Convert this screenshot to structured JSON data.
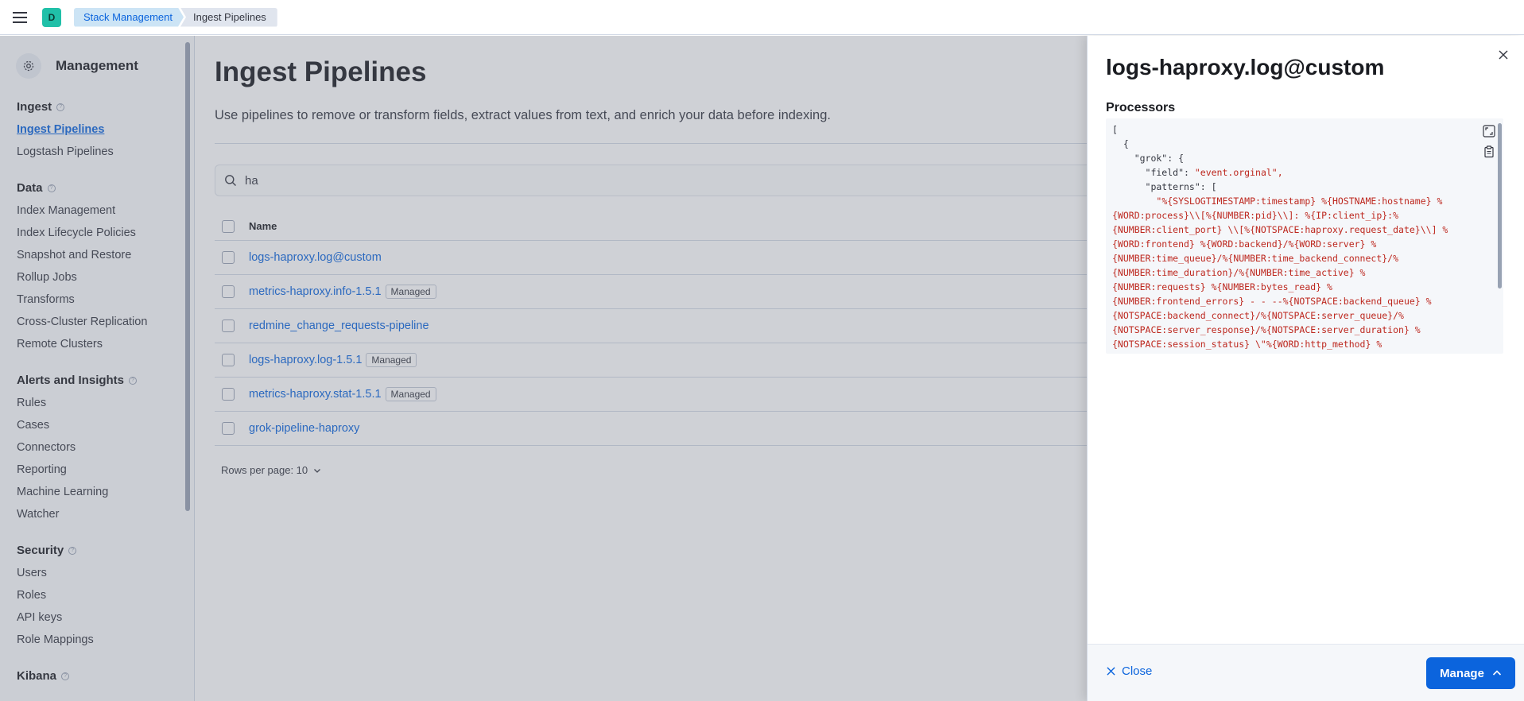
{
  "header": {
    "space_initial": "D",
    "breadcrumbs": [
      "Stack Management",
      "Ingest Pipelines"
    ]
  },
  "sidebar": {
    "title": "Management",
    "groups": [
      {
        "title": "Ingest",
        "items": [
          "Ingest Pipelines",
          "Logstash Pipelines"
        ]
      },
      {
        "title": "Data",
        "items": [
          "Index Management",
          "Index Lifecycle Policies",
          "Snapshot and Restore",
          "Rollup Jobs",
          "Transforms",
          "Cross-Cluster Replication",
          "Remote Clusters"
        ]
      },
      {
        "title": "Alerts and Insights",
        "items": [
          "Rules",
          "Cases",
          "Connectors",
          "Reporting",
          "Machine Learning",
          "Watcher"
        ]
      },
      {
        "title": "Security",
        "items": [
          "Users",
          "Roles",
          "API keys",
          "Role Mappings"
        ]
      },
      {
        "title": "Kibana",
        "items": []
      }
    ],
    "active_item": "Ingest Pipelines"
  },
  "main": {
    "title": "Ingest Pipelines",
    "description": "Use pipelines to remove or transform fields, extract values from text, and enrich your data before indexing.",
    "search_value": "ha",
    "table": {
      "name_header": "Name",
      "rows": [
        {
          "name": "logs-haproxy.log@custom",
          "badge": ""
        },
        {
          "name": "metrics-haproxy.info-1.5.1",
          "badge": "Managed"
        },
        {
          "name": "redmine_change_requests-pipeline",
          "badge": ""
        },
        {
          "name": "logs-haproxy.log-1.5.1",
          "badge": "Managed"
        },
        {
          "name": "metrics-haproxy.stat-1.5.1",
          "badge": "Managed"
        },
        {
          "name": "grok-pipeline-haproxy",
          "badge": ""
        }
      ]
    },
    "rows_per_page": "Rows per page: 10"
  },
  "flyout": {
    "title": "logs-haproxy.log@custom",
    "processors_label": "Processors",
    "code_lines": [
      {
        "k": "[",
        "s": ""
      },
      {
        "k": "  {",
        "s": ""
      },
      {
        "k": "    \"grok\": {",
        "s": ""
      },
      {
        "k": "      \"field\": ",
        "s": "\"event.orginal\","
      },
      {
        "k": "      \"patterns\": [",
        "s": ""
      },
      {
        "k": "        ",
        "s": "\"%{SYSLOGTIMESTAMP:timestamp} %{HOSTNAME:hostname} %"
      },
      {
        "k": "",
        "s": "{WORD:process}\\\\[%{NUMBER:pid}\\\\]: %{IP:client_ip}:%"
      },
      {
        "k": "",
        "s": "{NUMBER:client_port} \\\\[%{NOTSPACE:haproxy.request_date}\\\\] %"
      },
      {
        "k": "",
        "s": "{WORD:frontend} %{WORD:backend}/%{WORD:server} %"
      },
      {
        "k": "",
        "s": "{NUMBER:time_queue}/%{NUMBER:time_backend_connect}/%"
      },
      {
        "k": "",
        "s": "{NUMBER:time_duration}/%{NUMBER:time_active} %"
      },
      {
        "k": "",
        "s": "{NUMBER:requests} %{NUMBER:bytes_read} %"
      },
      {
        "k": "",
        "s": "{NUMBER:frontend_errors} - - --%{NOTSPACE:backend_queue} %"
      },
      {
        "k": "",
        "s": "{NOTSPACE:backend_connect}/%{NOTSPACE:server_queue}/%"
      },
      {
        "k": "",
        "s": "{NOTSPACE:server_response}/%{NOTSPACE:server_duration} %"
      },
      {
        "k": "",
        "s": "{NOTSPACE:session_status} \\\"%{WORD:http_method} %"
      }
    ],
    "close_label": "Close",
    "manage_label": "Manage"
  },
  "colors": {
    "accent": "#0b64dd",
    "space_avatar": "#20c0a8",
    "string": "#bd271e"
  }
}
